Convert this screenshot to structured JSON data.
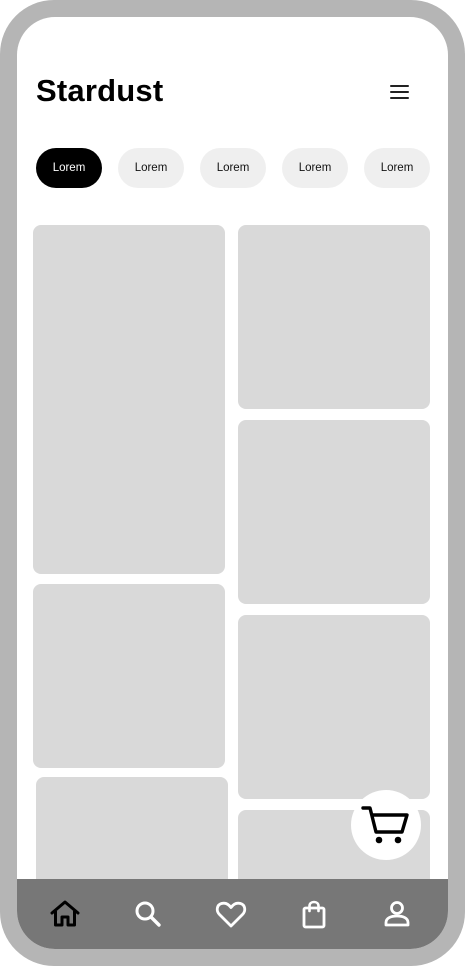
{
  "app": {
    "title": "Stardust"
  },
  "categories": [
    {
      "label": "Lorem",
      "selected": true
    },
    {
      "label": "Lorem",
      "selected": false
    },
    {
      "label": "Lorem",
      "selected": false
    },
    {
      "label": "Lorem",
      "selected": false
    },
    {
      "label": "Lorem",
      "selected": false
    }
  ],
  "icons": {
    "menu": "hamburger-menu-icon",
    "cart": "shopping-cart-icon",
    "nav": [
      "home-icon",
      "search-icon",
      "heart-icon",
      "shopping-bag-icon",
      "profile-icon"
    ]
  },
  "colors": {
    "frame": "#b5b5b5",
    "chip_active_bg": "#000000",
    "chip_inactive_bg": "#efefef",
    "card_placeholder": "#d9d9d9",
    "bottom_nav_bg": "#777777"
  },
  "bottom_nav": {
    "active_index": 0
  }
}
